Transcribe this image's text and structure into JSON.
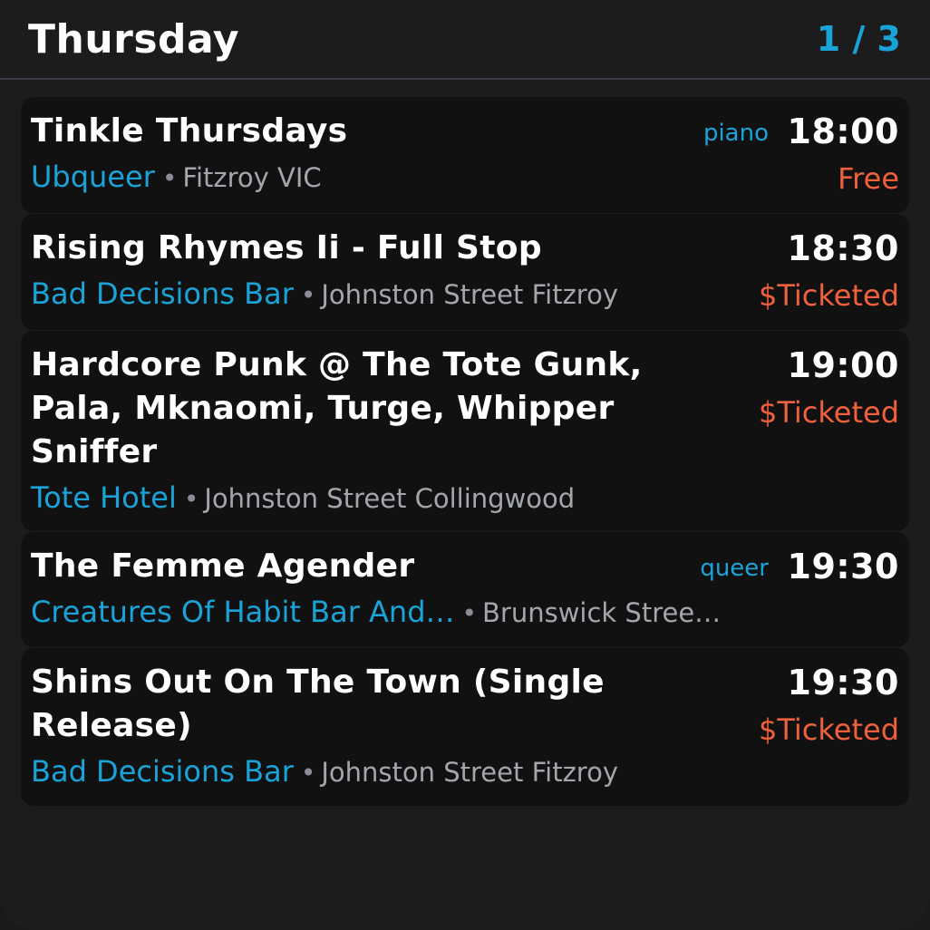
{
  "header": {
    "day": "Thursday",
    "page": "1 / 3"
  },
  "events": [
    {
      "title_lines": [
        "Tinkle Thursdays"
      ],
      "tag": "piano",
      "time": "18:00",
      "price": "Free",
      "venue": "Ubqueer",
      "location": "Fitzroy VIC"
    },
    {
      "title_lines": [
        "Rising Rhymes Ii - Full Stop"
      ],
      "tag": "",
      "time": "18:30",
      "price": "$Ticketed",
      "venue": "Bad Decisions Bar",
      "location": "Johnston Street Fitzroy"
    },
    {
      "title_lines": [
        "Hardcore Punk @ The Tote Gunk,",
        "Pala, Mknaomi, Turge, Whipper",
        "Sniffer"
      ],
      "tag": "",
      "time": "19:00",
      "price": "$Ticketed",
      "venue": "Tote Hotel",
      "location": "Johnston Street Collingwood"
    },
    {
      "title_lines": [
        "The Femme Agender"
      ],
      "tag": "queer",
      "time": "19:30",
      "price": "",
      "venue": "Creatures Of Habit Bar And…",
      "location": "Brunswick Stree…"
    },
    {
      "title_lines": [
        "Shins Out On The Town (Single",
        "Release)"
      ],
      "tag": "",
      "time": "19:30",
      "price": "$Ticketed",
      "venue": "Bad Decisions Bar",
      "location": "Johnston Street Fitzroy"
    }
  ],
  "colors": {
    "accent": "#1aa3d8",
    "price": "#f0603c",
    "card_bg": "#111111",
    "page_bg": "#1c1c1c"
  }
}
